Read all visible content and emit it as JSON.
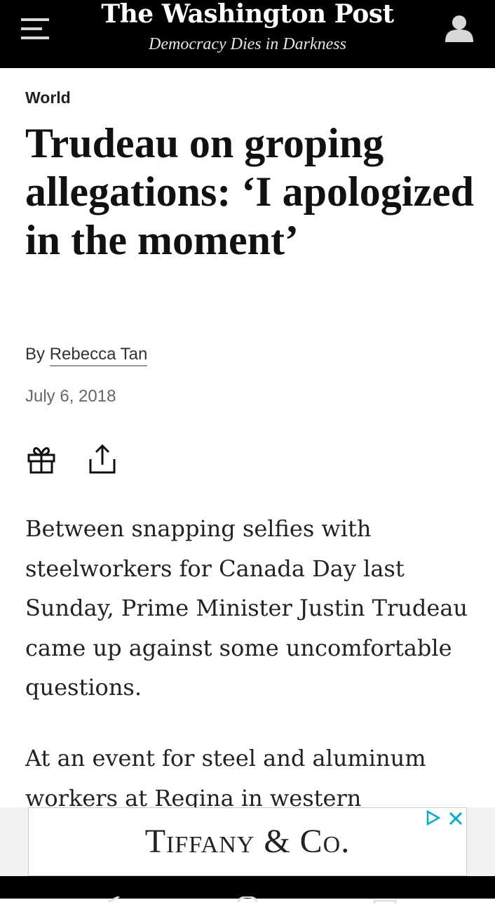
{
  "header": {
    "logo": "The Washington Post",
    "tagline": "Democracy Dies in Darkness",
    "menu_icon": "hamburger-menu-icon",
    "account_icon": "user-icon"
  },
  "article": {
    "section": "World",
    "headline": "Trudeau on groping allegations: ‘I apologized in the moment’",
    "byline_prefix": "By",
    "author": "Rebecca Tan",
    "date": "July 6, 2018",
    "actions": {
      "gift_icon": "gift-icon",
      "share_icon": "share-icon"
    },
    "paragraphs": [
      "Between snapping selfies with steelworkers for Canada Day last Sunday, Prime Minister Justin Trudeau came up against some uncomfortable questions.",
      "At an event for steel and aluminum workers at Regina in western"
    ]
  },
  "ad": {
    "brand": "Tiffany & Co.",
    "adchoices_icon": "play-triangle-icon",
    "close_icon": "close-icon",
    "accent_color": "#00aecd"
  },
  "system_nav": {
    "back_icon": "back-icon",
    "home_icon": "home-icon",
    "recents_icon": "recents-icon"
  },
  "colors": {
    "header_bg": "#000000",
    "page_bg": "#ffffff",
    "text": "#111111"
  }
}
